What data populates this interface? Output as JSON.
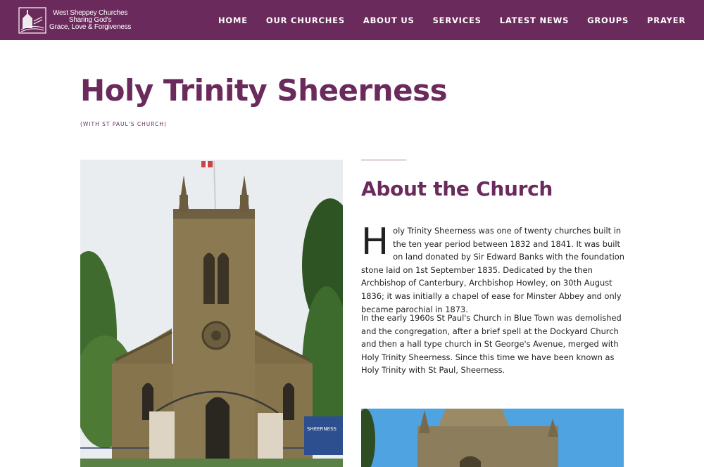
{
  "header": {
    "logo_lines": [
      "West Sheppey Churches",
      "Sharing God's",
      "Grace, Love & Forgiveness"
    ],
    "nav": [
      "HOME",
      "OUR CHURCHES",
      "ABOUT US",
      "SERVICES",
      "LATEST NEWS",
      "GROUPS",
      "PRAYER"
    ]
  },
  "page": {
    "title": "Holy Trinity Sheerness",
    "subtitle": "(WITH ST PAUL'S CHURCH)"
  },
  "about": {
    "heading": "About the Church",
    "dropcap": "H",
    "para1_rest": "oly Trinity Sheerness was one of twenty churches built in the ten year period between 1832 and 1841. It was built on land donated by Sir Edward Banks with the foundation stone laid on 1st September 1835. Dedicated by the then Archbishop of Canterbury, Archbishop Howley, on 30th August 1836; it was initially a chapel of ease for Minster Abbey and only became parochial in 1873.",
    "para2": "In the early 1960s St Paul's Church in Blue Town was demolished and the congregation, after a brief spell at the Dockyard Church and then a hall type church in St George's Avenue, merged with Holy Trinity Sheerness. Since this time we have been known as Holy Trinity with St Paul, Sheerness."
  },
  "images": {
    "sign_text": "SHEERNESS"
  },
  "colors": {
    "brand": "#6b2a5c",
    "text": "#222222"
  }
}
